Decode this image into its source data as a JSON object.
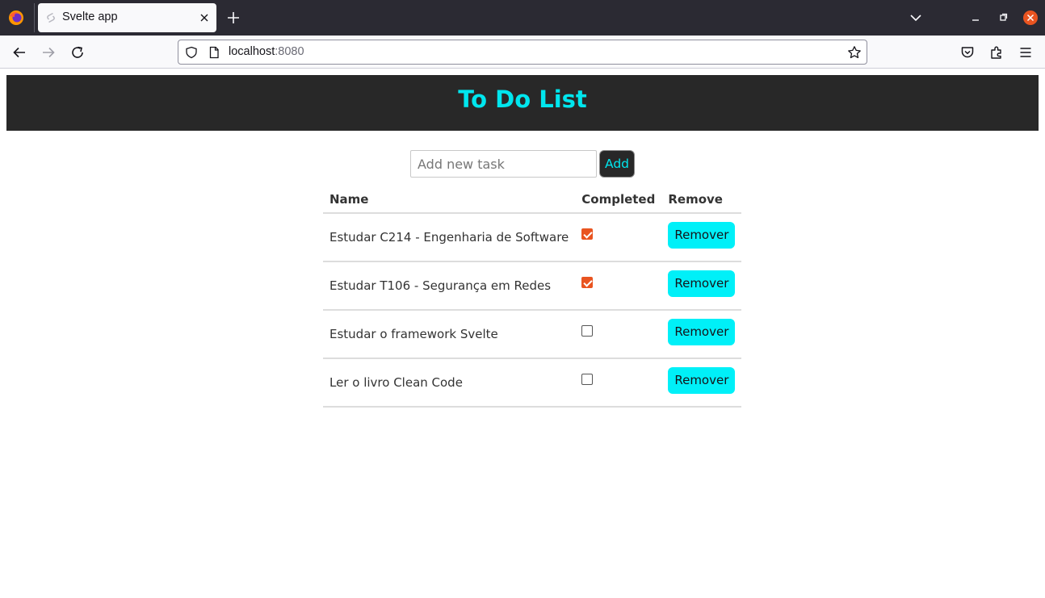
{
  "browser": {
    "tab_title": "Svelte app",
    "url_host": "localhost",
    "url_port": ":8080"
  },
  "app": {
    "title": "To Do List",
    "input_placeholder": "Add new task",
    "add_label": "Add"
  },
  "table": {
    "headers": [
      "Name",
      "Completed",
      "Remove"
    ],
    "remove_label": "Remover",
    "rows": [
      {
        "name": "Estudar C214 - Engenharia de Software",
        "completed": true
      },
      {
        "name": "Estudar T106 - Segurança em Redes",
        "completed": true
      },
      {
        "name": "Estudar o framework Svelte",
        "completed": false
      },
      {
        "name": "Ler o livro Clean Code",
        "completed": false
      }
    ]
  },
  "colors": {
    "accent": "#00e6ee",
    "header_bg": "#282828",
    "checkbox_checked": "#e95420"
  }
}
